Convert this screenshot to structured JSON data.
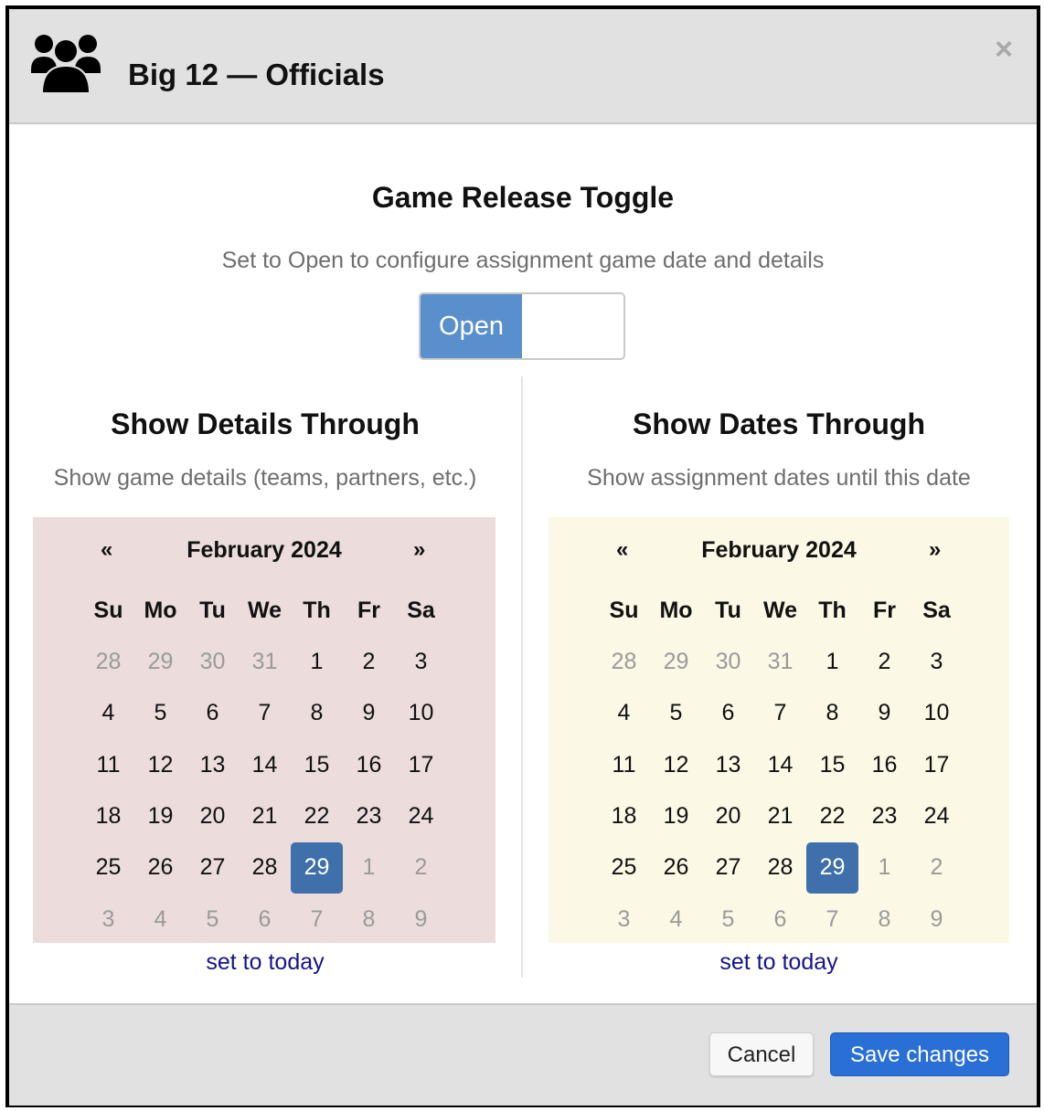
{
  "modal": {
    "title": "Big 12 — Officials",
    "icon": "users-group-icon",
    "close_label": "×"
  },
  "release": {
    "title": "Game Release Toggle",
    "subtitle": "Set to Open to configure assignment game date and details",
    "toggle_label": "Open",
    "toggle_state": "open"
  },
  "details": {
    "title": "Show Details Through",
    "subtitle": "Show game details (teams, partners, etc.)",
    "today_link": "set to today"
  },
  "dates": {
    "title": "Show Dates Through",
    "subtitle": "Show assignment dates until this date",
    "today_link": "set to today"
  },
  "calendar": {
    "prev": "«",
    "next": "»",
    "month": "February 2024",
    "weekdays": [
      "Su",
      "Mo",
      "Tu",
      "We",
      "Th",
      "Fr",
      "Sa"
    ],
    "weeks": [
      [
        "28",
        "29",
        "30",
        "31",
        "1",
        "2",
        "3"
      ],
      [
        "4",
        "5",
        "6",
        "7",
        "8",
        "9",
        "10"
      ],
      [
        "11",
        "12",
        "13",
        "14",
        "15",
        "16",
        "17"
      ],
      [
        "18",
        "19",
        "20",
        "21",
        "22",
        "23",
        "24"
      ],
      [
        "25",
        "26",
        "27",
        "28",
        "29",
        "1",
        "2"
      ],
      [
        "3",
        "4",
        "5",
        "6",
        "7",
        "8",
        "9"
      ]
    ],
    "selected_day": "29"
  },
  "colors": {
    "details_calendar_bg": "#ecdcdc",
    "dates_calendar_bg": "#fbf8e5",
    "toggle_on": "#5a8fce",
    "selected_day": "#3f70ab",
    "primary_button": "#2a6fd6",
    "link": "#14148c"
  },
  "footer": {
    "cancel_label": "Cancel",
    "save_label": "Save changes"
  }
}
